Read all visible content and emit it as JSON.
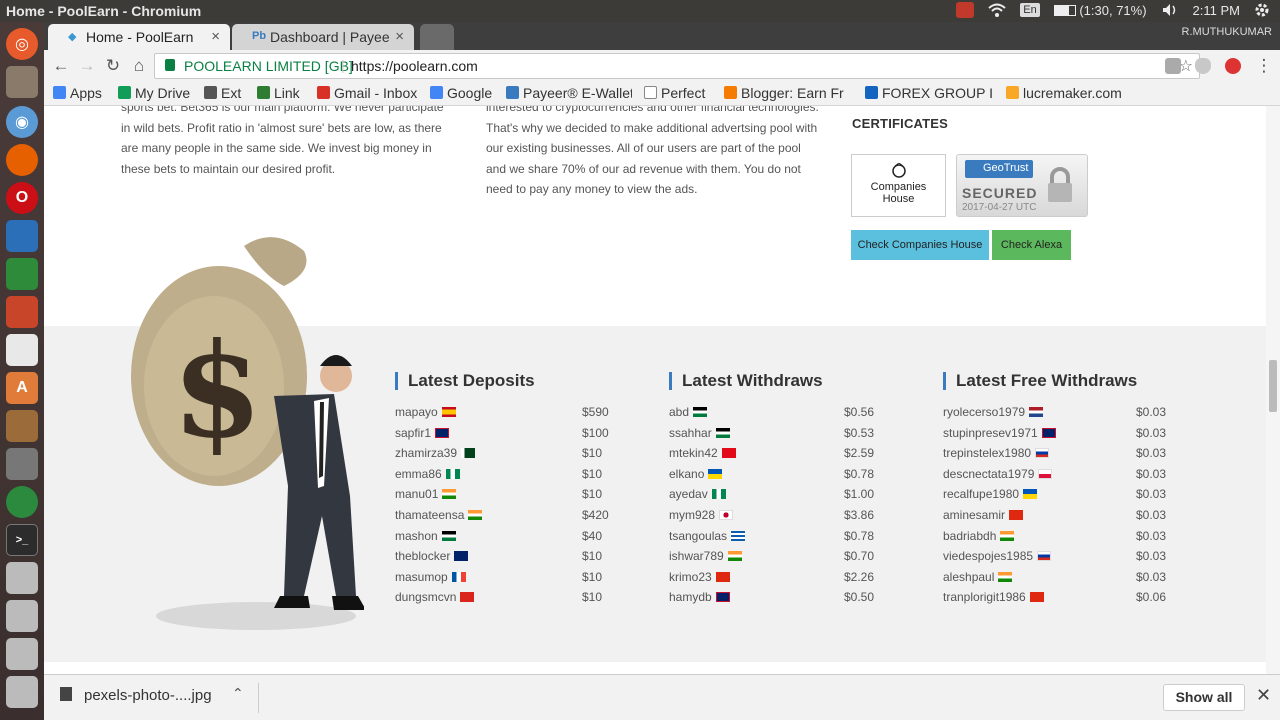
{
  "window": {
    "title": "Home - PoolEarn - Chromium"
  },
  "tray": {
    "language": "En",
    "battery": "(1:30, 71%)",
    "clock": "2:11 PM"
  },
  "profile": "R.MUTHUKUMAR",
  "tabs": [
    {
      "label": "Home - PoolEarn",
      "active": true
    },
    {
      "label": "Dashboard | Payee",
      "active": false
    }
  ],
  "address": {
    "ev_label": "POOLEARN LIMITED [GB]",
    "url": "https://poolearn.com"
  },
  "bookmarks": [
    {
      "label": "Apps",
      "color": "#4285f4"
    },
    {
      "label": "My Drive",
      "color": "#0f9d58"
    },
    {
      "label": "Ext",
      "color": "#555555"
    },
    {
      "label": "Link",
      "color": "#2e7d32"
    },
    {
      "label": "Gmail - Inbox",
      "color": "#d93025"
    },
    {
      "label": "Google",
      "color": "#4285f4"
    },
    {
      "label": "Payeer® E-Wallet",
      "color": "#3a7bbf"
    },
    {
      "label": "Perfect",
      "color": "#888888"
    },
    {
      "label": "Blogger: Earn Fr",
      "color": "#f57c00"
    },
    {
      "label": "FOREX GROUP IN",
      "color": "#1565c0"
    },
    {
      "label": "lucremaker.com",
      "color": "#f9a825"
    }
  ],
  "content": {
    "left_para": "sports bet. Bet365 is our main platform. We never participate in wild bets. Profit ratio in 'almost sure' bets are low, as there are many people in the same side. We invest big money in these bets to maintain our desired profit.",
    "mid_para": "interested to cryptocurrencies and other financial technologies. That's why we decided to make additional advertsing pool with our existing businesses. All of our users are part of the pool and we share 70% of our ad revenue with them. You do not need to pay any money to view the ads.",
    "certificates_heading": "CERTIFICATES",
    "companies_house_logo": "Companies House",
    "geotrust_brand": "GeoTrust",
    "geotrust_secured": "SECURED",
    "geotrust_date": "2017-04-27 UTC",
    "btn_companies_house": "Check Companies House",
    "btn_alexa": "Check Alexa"
  },
  "latest_deposits": {
    "heading": "Latest Deposits",
    "rows": [
      {
        "name": "mapayo",
        "flag": "es",
        "amount": "$590"
      },
      {
        "name": "sapfir1",
        "flag": "gb",
        "amount": "$100"
      },
      {
        "name": "zhamirza39",
        "flag": "pk",
        "amount": "$10"
      },
      {
        "name": "emma86",
        "flag": "ng",
        "amount": "$10"
      },
      {
        "name": "manu01",
        "flag": "in",
        "amount": "$10"
      },
      {
        "name": "thamateensa",
        "flag": "in",
        "amount": "$420"
      },
      {
        "name": "mashon",
        "flag": "ps",
        "amount": "$40"
      },
      {
        "name": "theblocker",
        "flag": "au",
        "amount": "$10"
      },
      {
        "name": "masumop",
        "flag": "fr",
        "amount": "$10"
      },
      {
        "name": "dungsmcvn",
        "flag": "vn",
        "amount": "$10"
      }
    ]
  },
  "latest_withdraws": {
    "heading": "Latest Withdraws",
    "rows": [
      {
        "name": "abd",
        "flag": "ps",
        "amount": "$0.56"
      },
      {
        "name": "ssahhar",
        "flag": "ps",
        "amount": "$0.53"
      },
      {
        "name": "mtekin42",
        "flag": "tr",
        "amount": "$2.59"
      },
      {
        "name": "elkano",
        "flag": "ua",
        "amount": "$0.78"
      },
      {
        "name": "ayedav",
        "flag": "ng",
        "amount": "$1.00"
      },
      {
        "name": "mym928",
        "flag": "jp",
        "amount": "$3.86"
      },
      {
        "name": "tsangoulas",
        "flag": "gr",
        "amount": "$0.78"
      },
      {
        "name": "ishwar789",
        "flag": "in",
        "amount": "$0.70"
      },
      {
        "name": "krimo23",
        "flag": "cn",
        "amount": "$2.26"
      },
      {
        "name": "hamydb",
        "flag": "gb",
        "amount": "$0.50"
      }
    ]
  },
  "latest_free_withdraws": {
    "heading": "Latest Free Withdraws",
    "rows": [
      {
        "name": "ryolecerso1979",
        "flag": "nl",
        "amount": "$0.03"
      },
      {
        "name": "stupinpresev1971",
        "flag": "gb",
        "amount": "$0.03"
      },
      {
        "name": "trepinstelex1980",
        "flag": "ru",
        "amount": "$0.03"
      },
      {
        "name": "descnectata1979",
        "flag": "pl",
        "amount": "$0.03"
      },
      {
        "name": "recalfupe1980",
        "flag": "ua",
        "amount": "$0.03"
      },
      {
        "name": "aminesamir",
        "flag": "cn",
        "amount": "$0.03"
      },
      {
        "name": "badriabdh",
        "flag": "in",
        "amount": "$0.03"
      },
      {
        "name": "viedespojes1985",
        "flag": "ru",
        "amount": "$0.03"
      },
      {
        "name": "aleshpaul",
        "flag": "in",
        "amount": "$0.03"
      },
      {
        "name": "tranplorigit1986",
        "flag": "cn",
        "amount": "$0.06"
      }
    ]
  },
  "download_shelf": {
    "file": "pexels-photo-....jpg",
    "show_all": "Show all"
  }
}
